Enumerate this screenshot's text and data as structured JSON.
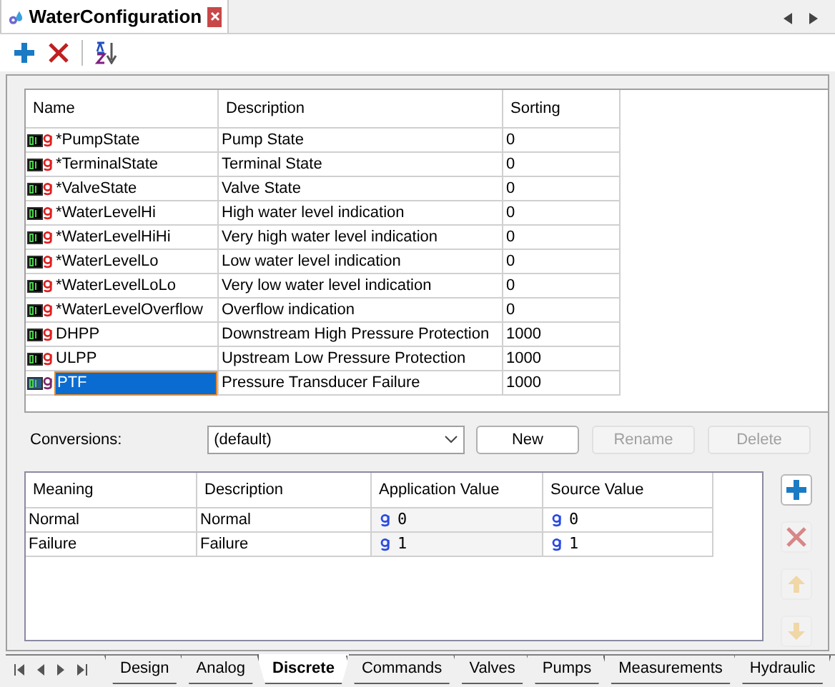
{
  "document_tab": {
    "title": "WaterConfiguration",
    "selected": true
  },
  "toolbar": {
    "buttons": [
      {
        "kind": "add"
      },
      {
        "kind": "delete"
      },
      {
        "kind": "sort"
      }
    ]
  },
  "points_table": {
    "columns": [
      "Name",
      "Description",
      "Sorting"
    ],
    "rows": [
      {
        "name": "*PumpState",
        "description": "Pump State",
        "sorting": "0",
        "selected": false
      },
      {
        "name": "*TerminalState",
        "description": "Terminal State",
        "sorting": "0",
        "selected": false
      },
      {
        "name": "*ValveState",
        "description": "Valve State",
        "sorting": "0",
        "selected": false
      },
      {
        "name": "*WaterLevelHi",
        "description": "High water level indication",
        "sorting": "0",
        "selected": false
      },
      {
        "name": "*WaterLevelHiHi",
        "description": "Very high water level indication",
        "sorting": "0",
        "selected": false
      },
      {
        "name": "*WaterLevelLo",
        "description": "Low water level indication",
        "sorting": "0",
        "selected": false
      },
      {
        "name": "*WaterLevelLoLo",
        "description": "Very low water level indication",
        "sorting": "0",
        "selected": false
      },
      {
        "name": "*WaterLevelOverflow",
        "description": "Overflow indication",
        "sorting": "0",
        "selected": false
      },
      {
        "name": "DHPP",
        "description": "Downstream High Pressure Protection",
        "sorting": "1000",
        "selected": false
      },
      {
        "name": "ULPP",
        "description": "Upstream Low Pressure Protection",
        "sorting": "1000",
        "selected": false
      },
      {
        "name": "PTF",
        "description": "Pressure Transducer Failure",
        "sorting": "1000",
        "selected": true
      }
    ]
  },
  "conversions": {
    "label": "Conversions:",
    "value": "(default)",
    "buttons": [
      {
        "label": "New",
        "disabled": false
      },
      {
        "label": "Rename",
        "disabled": true
      },
      {
        "label": "Delete",
        "disabled": true
      }
    ]
  },
  "conversion_table": {
    "columns": [
      "Meaning",
      "Description",
      "Application Value",
      "Source Value"
    ],
    "rows": [
      {
        "meaning": "Normal",
        "description": "Normal",
        "application_value": "0",
        "source_value": "0"
      },
      {
        "meaning": "Failure",
        "description": "Failure",
        "application_value": "1",
        "source_value": "1"
      }
    ]
  },
  "side_buttons": [
    {
      "kind": "add",
      "disabled": false
    },
    {
      "kind": "delete",
      "disabled": true
    },
    {
      "kind": "up",
      "disabled": true
    },
    {
      "kind": "down",
      "disabled": true
    }
  ],
  "sheet_tabs": [
    {
      "label": "Design",
      "selected": false
    },
    {
      "label": "Analog",
      "selected": false
    },
    {
      "label": "Discrete",
      "selected": true
    },
    {
      "label": "Commands",
      "selected": false
    },
    {
      "label": "Valves",
      "selected": false
    },
    {
      "label": "Pumps",
      "selected": false
    },
    {
      "label": "Measurements",
      "selected": false
    },
    {
      "label": "Hydraulic",
      "selected": false
    }
  ]
}
